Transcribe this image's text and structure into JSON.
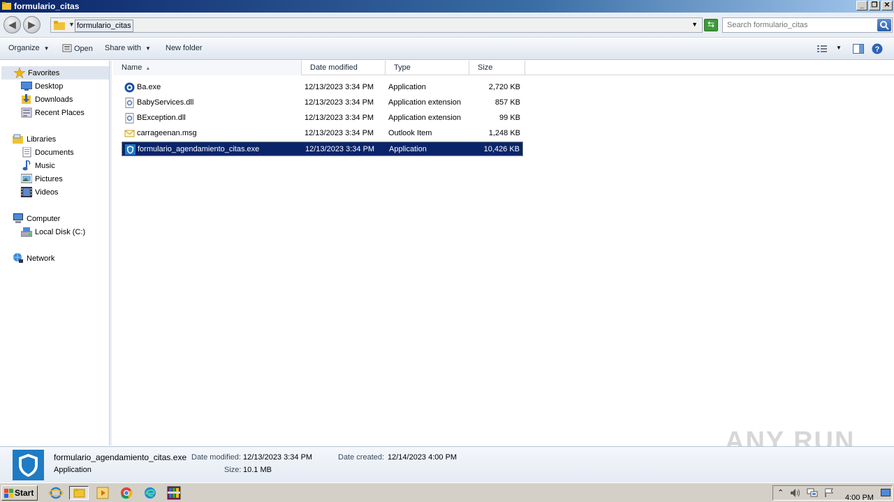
{
  "window": {
    "title": "formulario_citas"
  },
  "address": {
    "crumb": "formulario_citas",
    "search_placeholder": "Search formulario_citas"
  },
  "toolbar": {
    "organize": "Organize",
    "open": "Open",
    "share_with": "Share with",
    "new_folder": "New folder"
  },
  "nav": {
    "favorites": "Favorites",
    "desktop": "Desktop",
    "downloads": "Downloads",
    "recent_places": "Recent Places",
    "libraries": "Libraries",
    "documents": "Documents",
    "music": "Music",
    "pictures": "Pictures",
    "videos": "Videos",
    "computer": "Computer",
    "local_disk": "Local Disk (C:)",
    "network": "Network"
  },
  "columns": {
    "name": "Name",
    "date": "Date modified",
    "type": "Type",
    "size": "Size"
  },
  "files": [
    {
      "name": "Ba.exe",
      "date": "12/13/2023 3:34 PM",
      "type": "Application",
      "size": "2,720 KB",
      "icon": "exe-icon"
    },
    {
      "name": "BabyServices.dll",
      "date": "12/13/2023 3:34 PM",
      "type": "Application extension",
      "size": "857 KB",
      "icon": "dll-icon"
    },
    {
      "name": "BException.dll",
      "date": "12/13/2023 3:34 PM",
      "type": "Application extension",
      "size": "99 KB",
      "icon": "dll-icon"
    },
    {
      "name": "carrageenan.msg",
      "date": "12/13/2023 3:34 PM",
      "type": "Outlook Item",
      "size": "1,248 KB",
      "icon": "mail-icon"
    },
    {
      "name": "formulario_agendamiento_citas.exe",
      "date": "12/13/2023 3:34 PM",
      "type": "Application",
      "size": "10,426 KB",
      "icon": "shield-icon",
      "selected": true
    }
  ],
  "details": {
    "name": "formulario_agendamiento_citas.exe",
    "type": "Application",
    "date_modified_label": "Date modified:",
    "date_modified": "12/13/2023 3:34 PM",
    "date_created_label": "Date created:",
    "date_created": "12/14/2023 4:00 PM",
    "size_label": "Size:",
    "size": "10.1 MB"
  },
  "watermark": "ANY RUN",
  "taskbar": {
    "start": "Start",
    "clock": "4:00 PM"
  },
  "colors": {
    "selection": "#0a246a",
    "title_gradient_start": "#0a246a",
    "title_gradient_end": "#a6caf0"
  }
}
